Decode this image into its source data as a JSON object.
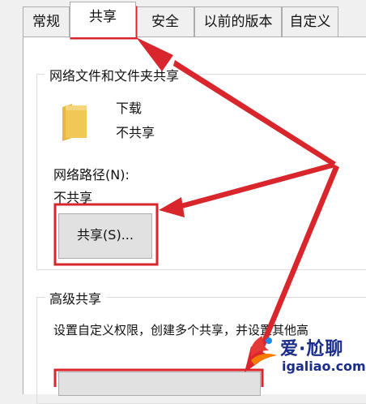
{
  "tabs": [
    {
      "label": "常规"
    },
    {
      "label": "共享"
    },
    {
      "label": "安全"
    },
    {
      "label": "以前的版本"
    },
    {
      "label": "自定义"
    }
  ],
  "network_sharing": {
    "group_title": "网络文件和文件夹共享",
    "folder_name": "下载",
    "folder_status": "不共享",
    "path_label": "网络路径(N):",
    "path_value": "不共享",
    "share_button": "共享(S)..."
  },
  "advanced_sharing": {
    "group_title": "高级共享",
    "description": "设置自定义权限，创建多个共享，并设置其他高"
  },
  "watermark": {
    "brand": "爱·尬聊",
    "site": "igaliao.com"
  },
  "colors": {
    "annotation_red": "#d9252c",
    "folder_yellow": "#f1c755",
    "watermark_blue": "#1a2c8c"
  }
}
